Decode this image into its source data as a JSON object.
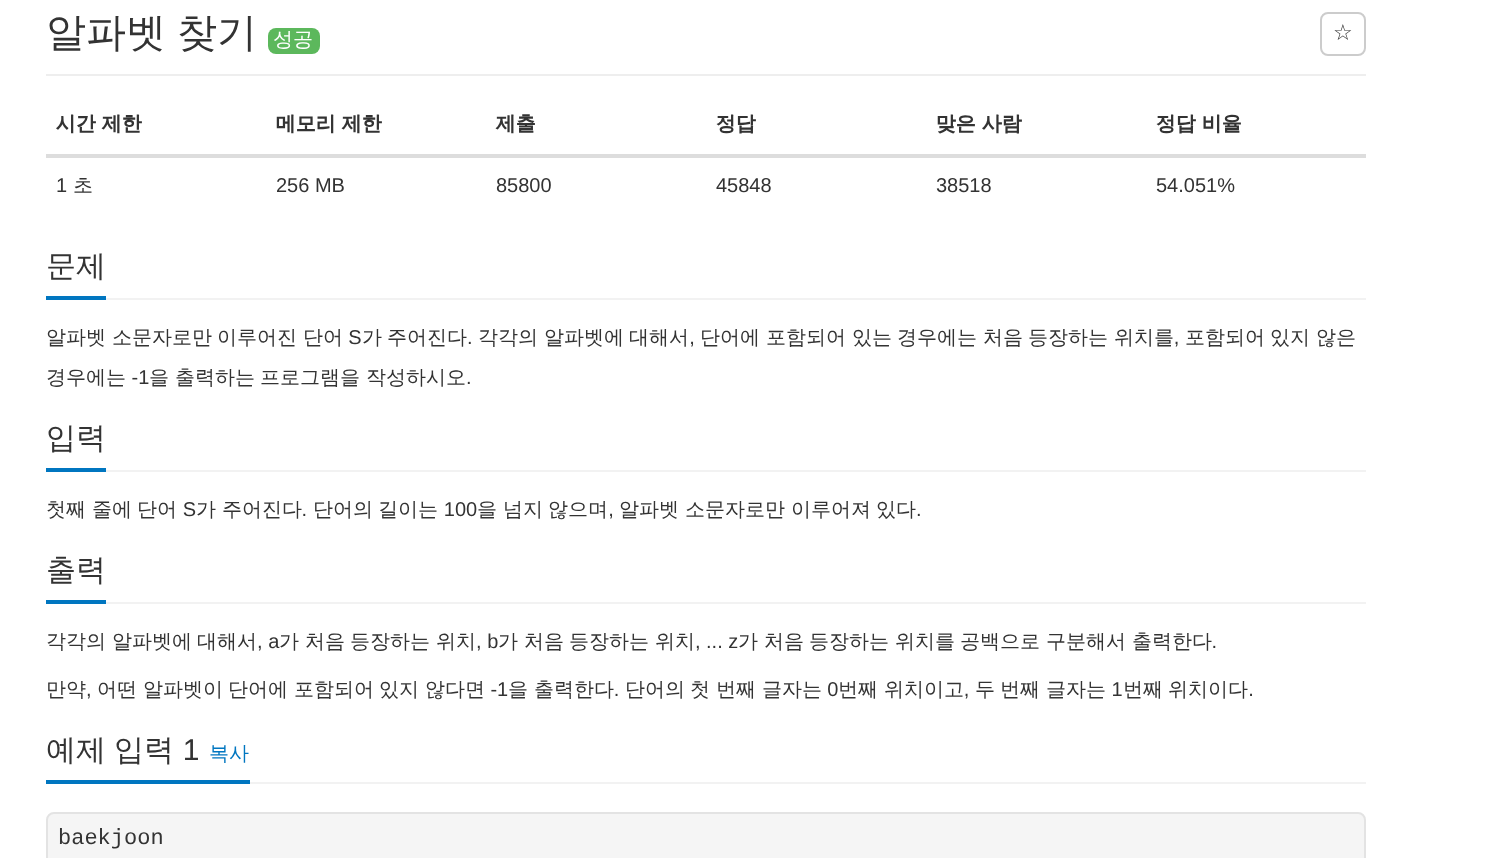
{
  "title": "알파벳 찾기",
  "badge": "성공",
  "star_button": "☆",
  "table": {
    "columns": [
      "시간 제한",
      "메모리 제한",
      "제출",
      "정답",
      "맞은 사람",
      "정답 비율"
    ],
    "rows": [
      [
        "1 초",
        "256 MB",
        "85800",
        "45848",
        "38518",
        "54.051%"
      ]
    ]
  },
  "sections": [
    {
      "heading": "문제",
      "paragraphs": [
        "알파벳 소문자로만 이루어진 단어 S가 주어진다. 각각의 알파벳에 대해서, 단어에 포함되어 있는 경우에는 처음 등장하는 위치를, 포함되어 있지 않은 경우에는 -1을 출력하는 프로그램을 작성하시오."
      ]
    },
    {
      "heading": "입력",
      "paragraphs": [
        "첫째 줄에 단어 S가 주어진다. 단어의 길이는 100을 넘지 않으며, 알파벳 소문자로만 이루어져 있다."
      ]
    },
    {
      "heading": "출력",
      "paragraphs": [
        "각각의 알파벳에 대해서, a가 처음 등장하는 위치, b가 처음 등장하는 위치, ... z가 처음 등장하는 위치를 공백으로 구분해서 출력한다.",
        "만약, 어떤 알파벳이 단어에 포함되어 있지 않다면 -1을 출력한다. 단어의 첫 번째 글자는 0번째 위치이고, 두 번째 글자는 1번째 위치이다."
      ]
    }
  ],
  "sample": {
    "heading": "예제 입력 1",
    "copy_link": "복사",
    "code": "baekjoon"
  }
}
